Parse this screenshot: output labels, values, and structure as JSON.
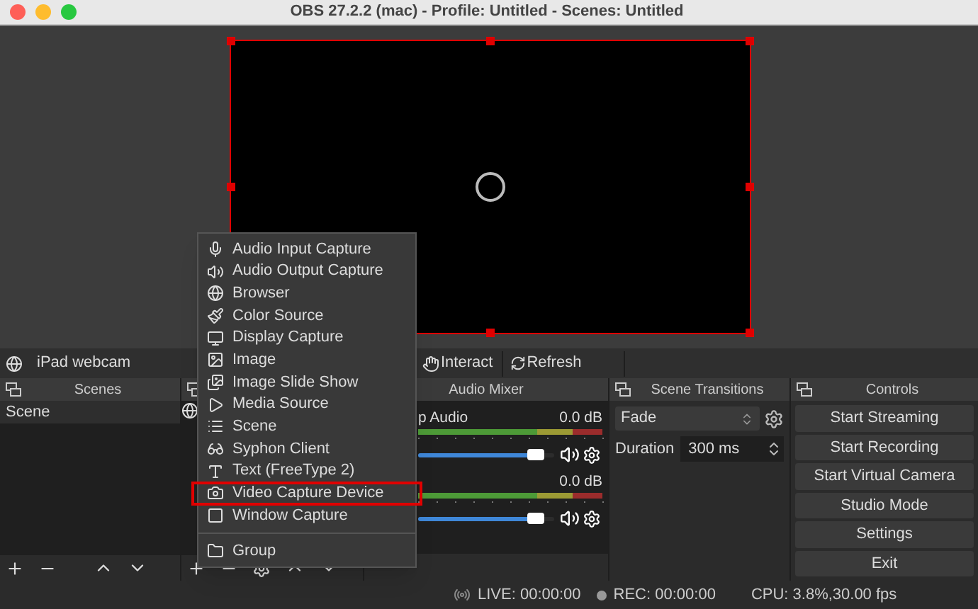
{
  "window": {
    "title": "OBS 27.2.2 (mac) - Profile: Untitled - Scenes: Untitled"
  },
  "toolbar": {
    "source_name": "iPad webcam",
    "buttons": [
      "Interact",
      "Refresh"
    ]
  },
  "scenes": {
    "title": "Scenes",
    "items": [
      {
        "label": "Scene",
        "selected": true
      }
    ]
  },
  "audio_mixer": {
    "title": "Audio Mixer",
    "channels": [
      {
        "name": "p Audio",
        "reading": "0.0 dB",
        "level": 0.93
      },
      {
        "reading": "0.0 dB",
        "level": 0.93
      }
    ]
  },
  "scene_transitions": {
    "title": "Scene Transitions",
    "transition": "Fade",
    "duration_label": "Duration",
    "duration": "300 ms"
  },
  "controls": {
    "title": "Controls",
    "buttons": [
      "Start Streaming",
      "Start Recording",
      "Start Virtual Camera",
      "Studio Mode",
      "Settings",
      "Exit"
    ]
  },
  "context_menu": {
    "items": [
      {
        "label": "Audio Input Capture",
        "highlighted": false
      },
      {
        "label": "Audio Output Capture",
        "highlighted": false
      },
      {
        "label": "Browser",
        "highlighted": false
      },
      {
        "label": "Color Source",
        "highlighted": false
      },
      {
        "label": "Display Capture",
        "highlighted": false
      },
      {
        "label": "Image",
        "highlighted": false
      },
      {
        "label": "Image Slide Show",
        "highlighted": false
      },
      {
        "label": "Media Source",
        "highlighted": false
      },
      {
        "label": "Scene",
        "highlighted": false
      },
      {
        "label": "Syphon Client",
        "highlighted": false
      },
      {
        "label": "Text (FreeType 2)",
        "highlighted": false
      },
      {
        "label": "Video Capture Device",
        "highlighted": true
      },
      {
        "label": "Window Capture",
        "highlighted": false
      }
    ],
    "group_items": [
      {
        "label": "Group",
        "highlighted": false
      }
    ]
  },
  "status_bar": {
    "live": "LIVE: 00:00:00",
    "rec": "REC: 00:00:00",
    "cpu": "CPU: 3.8%,30.00 fps"
  }
}
